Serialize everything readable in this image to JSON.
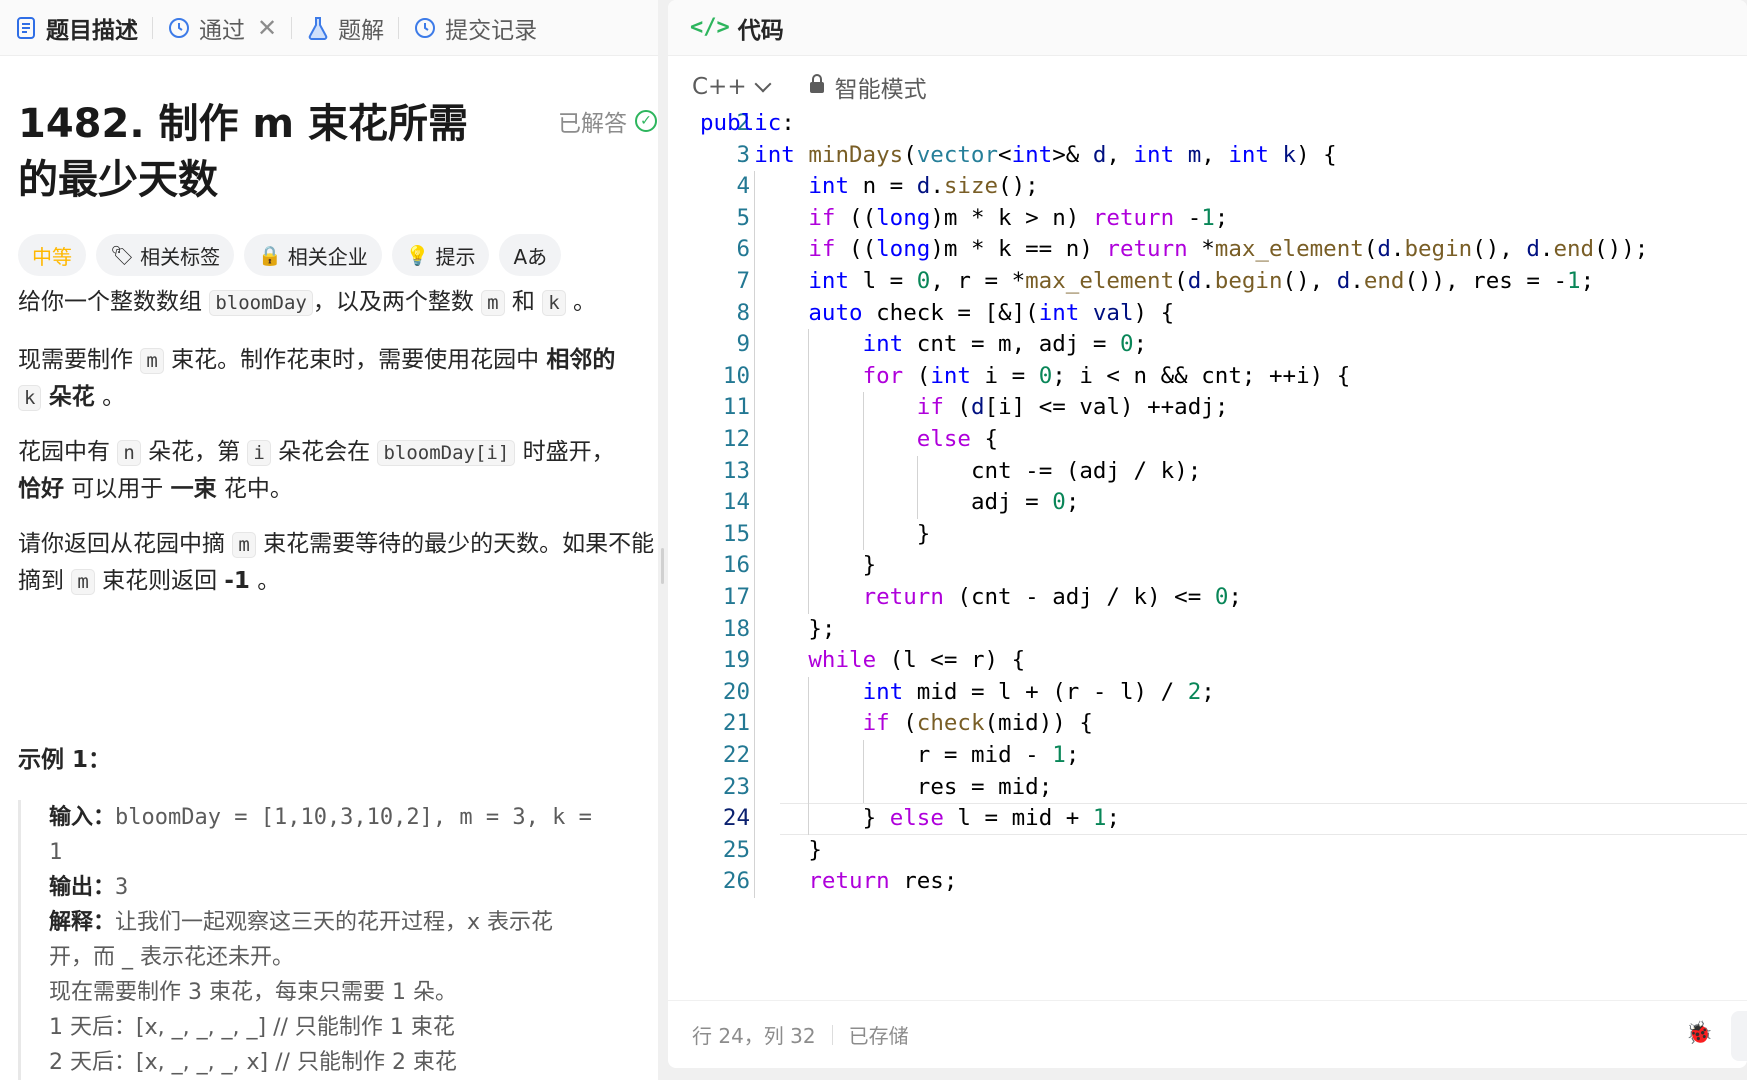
{
  "left_tabs": [
    {
      "label": "题目描述",
      "icon": "description-icon"
    },
    {
      "label": "通过",
      "icon": "history-icon"
    },
    {
      "label": "题解",
      "icon": "flask-icon"
    },
    {
      "label": "提交记录",
      "icon": "history-icon"
    }
  ],
  "problem": {
    "title": "1482. 制作 m 束花所需的最少天数",
    "status": "已解答",
    "tags": [
      "中等",
      "相关标签",
      "相关企业",
      "提示",
      "Aあ"
    ],
    "p1": {
      "a": "给你一个整数数组 ",
      "c1": "bloomDay",
      "b": "，以及两个整数 ",
      "c2": "m",
      "c": " 和 ",
      "c3": "k",
      "d": " 。"
    },
    "p2": {
      "a": "现需要制作 ",
      "c1": "m",
      "b": " 束花。制作花束时，需要使用花园中 ",
      "bold1": "相邻的",
      "c2": "k",
      "bold2": "朵花",
      "c": " 。"
    },
    "p3": {
      "a": "花园中有 ",
      "c1": "n",
      "b": " 朵花，第 ",
      "c2": "i",
      "c": " 朵花会在 ",
      "c3": "bloomDay[i]",
      "d": " 时盛开，",
      "bold1": "恰好",
      "e": " 可以用于 ",
      "bold2": "一束",
      "f": " 花中。"
    },
    "p4": {
      "a": "请你返回从花园中摘 ",
      "c1": "m",
      "b": " 束花需要等待的最少的天数。如果不能摘到 ",
      "c2": "m",
      "c": " 束花则返回 ",
      "bold1": "-1",
      "d": " 。"
    },
    "example_title": "示例 1：",
    "example": {
      "input_label": "输入：",
      "input": "bloomDay = [1,10,3,10,2], m = 3, k =",
      "input_cont": "1",
      "output_label": "输出：",
      "output": "3",
      "explain_label": "解释：",
      "explain_1": "让我们一起观察这三天的花开过程，x 表示花",
      "explain_2": "开，而 _ 表示花还未开。",
      "line_3": "现在需要制作 3 束花，每束只需要 1 朵。",
      "line_4": "1 天后：[x, _, _, _, _]   // 只能制作 1 束花",
      "line_5": "2 天后：[x, _, _, _, x]   // 只能制作 2 束花"
    }
  },
  "code_panel": {
    "tab_label": "代码",
    "language": "C++",
    "mode": "智能模式",
    "current_line": 24,
    "status_position": "行 24，列 32",
    "status_saved": "已存储"
  },
  "code_lines": [
    {
      "n": "2",
      "indent": 0,
      "html": "<span class='kw'>public</span>:"
    },
    {
      "n": "3",
      "indent": 1,
      "html": "<span class='kw'>int</span> <span class='fn'>minDays</span>(<span class='ty'>vector</span>&lt;<span class='kw'>int</span>&gt;&amp; <span class='var'>d</span>, <span class='kw'>int</span> <span class='var'>m</span>, <span class='kw'>int</span> <span class='var'>k</span>) {"
    },
    {
      "n": "4",
      "indent": 2,
      "html": "<span class='kw'>int</span> n = <span class='var'>d</span>.<span class='fn'>size</span>();"
    },
    {
      "n": "5",
      "indent": 2,
      "html": "<span class='ctl'>if</span> ((<span class='kw'>long</span>)m * k &gt; n) <span class='ctl'>return</span> -<span class='num'>1</span>;"
    },
    {
      "n": "6",
      "indent": 2,
      "html": "<span class='ctl'>if</span> ((<span class='kw'>long</span>)m * k == n) <span class='ctl'>return</span> *<span class='fn'>max_element</span>(<span class='var'>d</span>.<span class='fn'>begin</span>(), <span class='var'>d</span>.<span class='fn'>end</span>());"
    },
    {
      "n": "7",
      "indent": 2,
      "html": "<span class='kw'>int</span> l = <span class='num'>0</span>, r = *<span class='fn'>max_element</span>(<span class='var'>d</span>.<span class='fn'>begin</span>(), <span class='var'>d</span>.<span class='fn'>end</span>()), res = -<span class='num'>1</span>;"
    },
    {
      "n": "8",
      "indent": 2,
      "html": "<span class='kw'>auto</span> check = [&amp;](<span class='kw'>int</span> <span class='var'>val</span>) {"
    },
    {
      "n": "9",
      "indent": 3,
      "html": "<span class='kw'>int</span> cnt = m, adj = <span class='num'>0</span>;"
    },
    {
      "n": "10",
      "indent": 3,
      "html": "<span class='ctl'>for</span> (<span class='kw'>int</span> i = <span class='num'>0</span>; i &lt; n &amp;&amp; cnt; ++i) {"
    },
    {
      "n": "11",
      "indent": 4,
      "html": "<span class='ctl'>if</span> (<span class='var'>d</span>[i] &lt;= val) ++adj;"
    },
    {
      "n": "12",
      "indent": 4,
      "html": "<span class='ctl'>else</span> {"
    },
    {
      "n": "13",
      "indent": 5,
      "html": "cnt -= (adj / k);"
    },
    {
      "n": "14",
      "indent": 5,
      "html": "adj = <span class='num'>0</span>;"
    },
    {
      "n": "15",
      "indent": 4,
      "html": "}"
    },
    {
      "n": "16",
      "indent": 3,
      "html": "}"
    },
    {
      "n": "17",
      "indent": 3,
      "html": "<span class='ctl'>return</span> (cnt - adj / k) &lt;= <span class='num'>0</span>;"
    },
    {
      "n": "18",
      "indent": 2,
      "html": "};"
    },
    {
      "n": "19",
      "indent": 2,
      "html": "<span class='ctl'>while</span> (l &lt;= r) {"
    },
    {
      "n": "20",
      "indent": 3,
      "html": "<span class='kw'>int</span> mid = l + (r - l) / <span class='num'>2</span>;"
    },
    {
      "n": "21",
      "indent": 3,
      "html": "<span class='ctl'>if</span> (<span class='fn'>check</span>(mid)) {"
    },
    {
      "n": "22",
      "indent": 4,
      "html": "r = mid - <span class='num'>1</span>;"
    },
    {
      "n": "23",
      "indent": 4,
      "html": "res = mid;"
    },
    {
      "n": "24",
      "indent": 3,
      "html": "} <span class='ctl'>else</span> l = mid + <span class='num'>1</span>;"
    },
    {
      "n": "25",
      "indent": 2,
      "html": "}"
    },
    {
      "n": "26",
      "indent": 2,
      "html": "<span class='ctl'>return</span> res;"
    }
  ]
}
